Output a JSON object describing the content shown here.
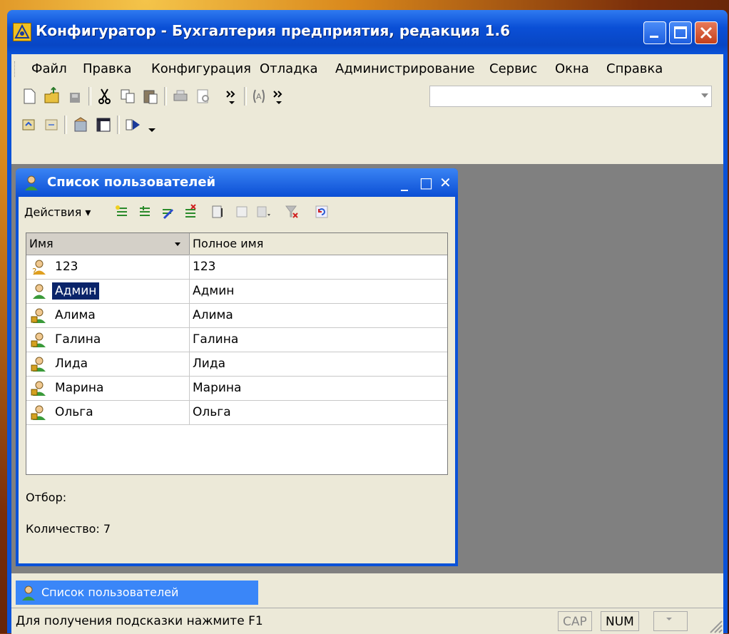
{
  "window": {
    "title": "Конфигуратор - Бухгалтерия предприятия, редакция 1.6"
  },
  "menu": {
    "items": [
      {
        "label": "Файл"
      },
      {
        "label": "Правка"
      },
      {
        "label": "Конфигурация"
      },
      {
        "label": "Отладка"
      },
      {
        "label": "Администрирование"
      },
      {
        "label": "Сервис"
      },
      {
        "label": "Окна"
      },
      {
        "label": "Справка"
      }
    ]
  },
  "toolbar1": {
    "icons": [
      "new-file-icon",
      "open-folder-icon",
      "save-icon",
      "cut-icon",
      "copy-icon",
      "paste-icon",
      "print-icon",
      "preview-icon",
      "more-icon",
      "syntax-icon",
      "more-icon"
    ],
    "combo_value": ""
  },
  "toolbar2": {
    "icons": [
      "config-load-icon",
      "config-compare-icon",
      "database-icon",
      "window-icon",
      "run-icon"
    ]
  },
  "child_window": {
    "title": "Список пользователей",
    "actions_label": "Действия",
    "columns": [
      "Имя",
      "Полное имя"
    ],
    "rows": [
      {
        "name": "123",
        "full_name": "123",
        "icon": "user-question-icon",
        "selected": false
      },
      {
        "name": "Админ",
        "full_name": "Админ",
        "icon": "user-admin-icon",
        "selected": true
      },
      {
        "name": "Алима",
        "full_name": "Алима",
        "icon": "user-lock-icon",
        "selected": false
      },
      {
        "name": "Галина",
        "full_name": "Галина",
        "icon": "user-lock-icon",
        "selected": false
      },
      {
        "name": "Лида",
        "full_name": "Лида",
        "icon": "user-lock-icon",
        "selected": false
      },
      {
        "name": "Марина",
        "full_name": "Марина",
        "icon": "user-lock-icon",
        "selected": false
      },
      {
        "name": "Ольга",
        "full_name": "Ольга",
        "icon": "user-lock-icon",
        "selected": false
      }
    ],
    "filter_label": "Отбор:",
    "count_label": "Количество: 7"
  },
  "taskbar": {
    "button_label": "Список пользователей"
  },
  "statusbar": {
    "hint": "Для получения подсказки нажмите F1",
    "cap": "CAP",
    "num": "NUM"
  },
  "colors": {
    "titlebar": "#0a52d8",
    "selection": "#0a246a",
    "client_bg": "#ece9d8",
    "mdi_bg": "#808080"
  }
}
